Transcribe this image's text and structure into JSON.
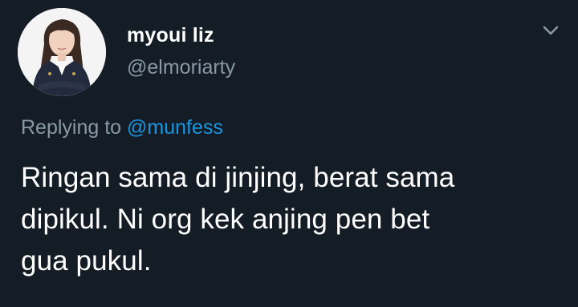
{
  "user": {
    "display_name": "myoui liz",
    "handle": "@elmoriarty",
    "avatar_icon": "profile-photo"
  },
  "menu": {
    "icon": "chevron-down-icon"
  },
  "reply": {
    "prefix": "Replying to",
    "mention": "@munfess"
  },
  "tweet": {
    "line1": "Ringan sama di jinjing, berat sama",
    "line2": "dipikul. Ni org kek anjing pen bet",
    "line3": "gua pukul."
  },
  "colors": {
    "background": "#141d26",
    "secondary_text": "#8899a6",
    "link": "#1b95e0"
  }
}
